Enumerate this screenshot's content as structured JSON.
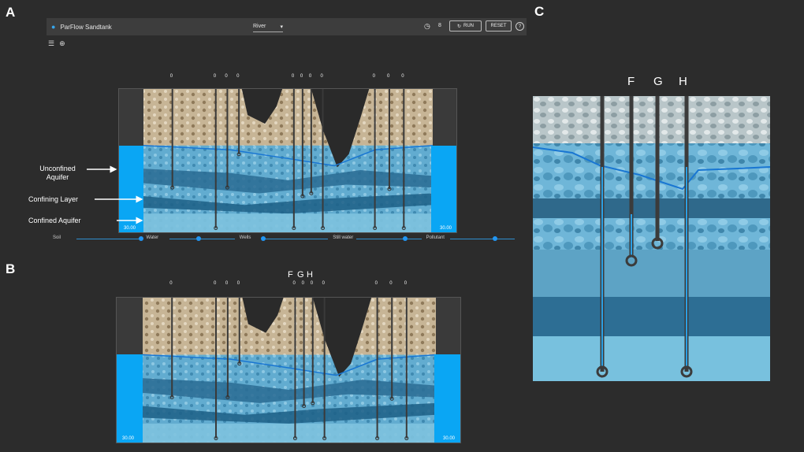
{
  "panels": {
    "a": "A",
    "b": "B",
    "c": "C"
  },
  "app": {
    "title": "ParFlow Sandtank",
    "scenario": "River",
    "duration": "8",
    "run_label": "RUN",
    "reset_label": "RESET",
    "help": "?"
  },
  "annotations": {
    "unconfined": "Unconfined\nAquifer",
    "confining": "Confining Layer",
    "confined": "Confined Aquifer"
  },
  "reservoirs": {
    "left": "30.00",
    "right": "30.00"
  },
  "wells": [
    "0",
    "0",
    "0",
    "0",
    "0",
    "0",
    "0",
    "0",
    "0",
    "0",
    "0"
  ],
  "well_letters": {
    "f": "F",
    "g": "G",
    "h": "H"
  },
  "sliders": [
    {
      "label": "Soil",
      "value": 1.0
    },
    {
      "label": "Water",
      "value": 0.45
    },
    {
      "label": "Wells",
      "value": 0.0
    },
    {
      "label": "Still water",
      "value": 0.75
    },
    {
      "label": "Pollutant",
      "value": 0.7
    }
  ],
  "colors": {
    "accent": "#2196f3",
    "water": "#0aa6f4",
    "sand": "#c8b896",
    "aquifer": "#5aaed3",
    "clay": "#1d5f86"
  }
}
